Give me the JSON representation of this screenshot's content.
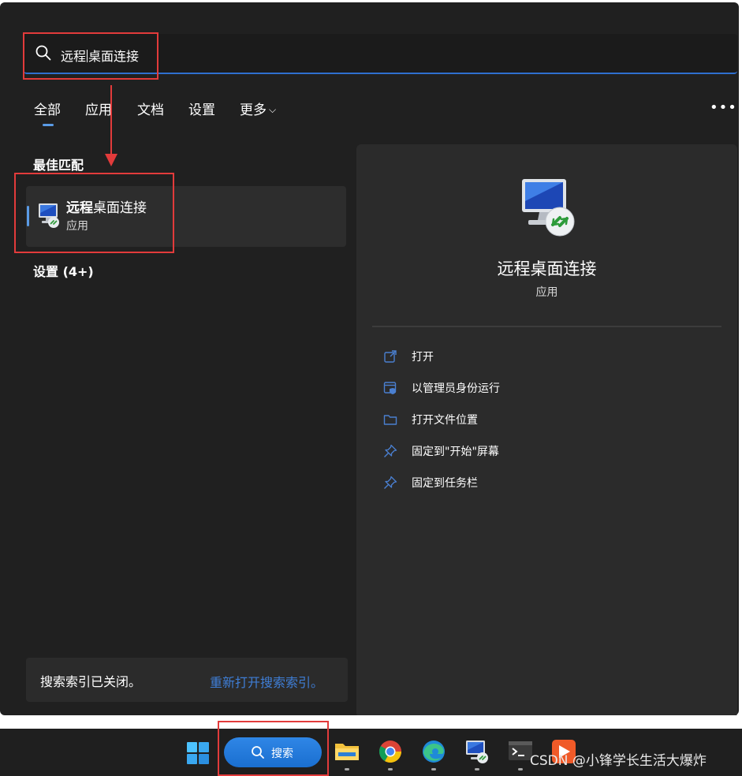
{
  "search": {
    "query_before_caret": "远程",
    "query_after_caret": "桌面连接"
  },
  "tabs": [
    {
      "label": "全部",
      "active": true
    },
    {
      "label": "应用",
      "active": false
    },
    {
      "label": "文档",
      "active": false
    },
    {
      "label": "设置",
      "active": false
    },
    {
      "label": "更多",
      "active": false,
      "dropdown": true
    }
  ],
  "more_menu_glyph": "•••",
  "dropdown_glyph": "⌵",
  "results": {
    "best_match_heading": "最佳匹配",
    "best_match": {
      "title_bold": "远程",
      "title_rest": "桌面连接",
      "subtitle": "应用"
    },
    "settings_heading": "设置 (4+)"
  },
  "index_notice": {
    "message": "搜索索引已关闭。",
    "link": "重新打开搜索索引。"
  },
  "detail": {
    "app_name": "远程桌面连接",
    "app_kind": "应用",
    "actions": [
      {
        "label": "打开",
        "icon": "open-external-icon"
      },
      {
        "label": "以管理员身份运行",
        "icon": "shield-admin-icon"
      },
      {
        "label": "打开文件位置",
        "icon": "folder-icon"
      },
      {
        "label": "固定到\"开始\"屏幕",
        "icon": "pin-icon"
      },
      {
        "label": "固定到任务栏",
        "icon": "pin-icon"
      }
    ]
  },
  "taskbar": {
    "search_label": "搜索",
    "apps": [
      "file-explorer-icon",
      "chrome-icon",
      "edge-icon",
      "remote-desktop-icon",
      "terminal-icon",
      "media-player-icon"
    ]
  },
  "watermark": "CSDN @小锋学长生活大爆炸",
  "colors": {
    "accent": "#5a9be6",
    "link": "#3f7ed6",
    "annotation": "#e23b3b",
    "window_bg": "#202020",
    "panel_bg": "#2b2b2b"
  }
}
